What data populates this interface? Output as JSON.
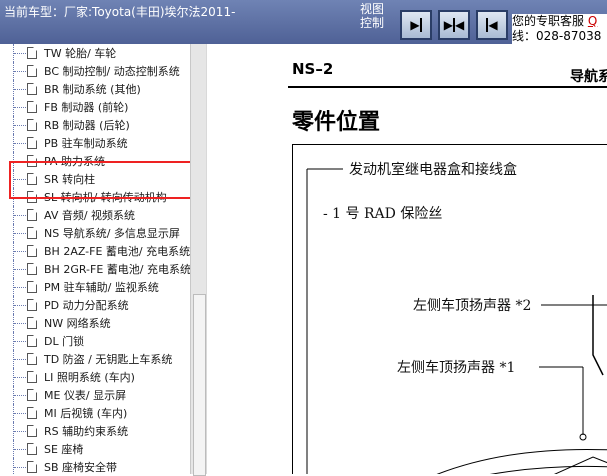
{
  "header": {
    "vehicle_title": "当前车型：厂家:Toyota(丰田)埃尔法2011-",
    "view_control_label": "视图控制",
    "support_line1": "您的专职客服",
    "support_q": "Q",
    "support_line2": "线：028-87038"
  },
  "nav_buttons": [
    {
      "name": "first-page",
      "icon": "arrow-right-bar-icon"
    },
    {
      "name": "prev-next",
      "icon": "double-arrow-icon"
    },
    {
      "name": "last-page",
      "icon": "arrow-left-bar-icon"
    }
  ],
  "tree": {
    "items": [
      "TW 轮胎/ 车轮",
      "BC 制动控制/ 动态控制系统",
      "BR 制动系统 (其他)",
      "FB 制动器 (前轮)",
      "RB 制动器 (后轮)",
      "PB 驻车制动系统",
      "PA 助力系统",
      "SR 转向柱",
      "SL 转向机/ 转向传动机构",
      "AV 音频/ 视频系统",
      "NS 导航系统/ 多信息显示屏",
      "BH 2AZ-FE 蓄电池/ 充电系统",
      "BH 2GR-FE 蓄电池/ 充电系统",
      "PM 驻车辅助/ 监视系统",
      "PD 动力分配系统",
      "NW 网络系统",
      "DL 门锁",
      "TD 防盗 / 无钥匙上车系统",
      "LI 照明系统 (车内)",
      "ME 仪表/ 显示屏",
      "MI 后视镜 (车内)",
      "RS 辅助约束系统",
      "SE 座椅",
      "SB 座椅安全带"
    ]
  },
  "document": {
    "code": "NS–2",
    "section_title": "导航系",
    "heading": "零件位置",
    "labels": {
      "engine_relay_box": "发动机室继电器盒和接线盒",
      "rad_fuse": "- 1 号 RAD 保险丝",
      "left_roof_speaker_2": "左侧车顶扬声器 *2",
      "left_roof_speaker_1": "左侧车顶扬声器 *1"
    }
  },
  "colors": {
    "header_bg": "#5a6ca2",
    "highlight": "#e22222"
  }
}
